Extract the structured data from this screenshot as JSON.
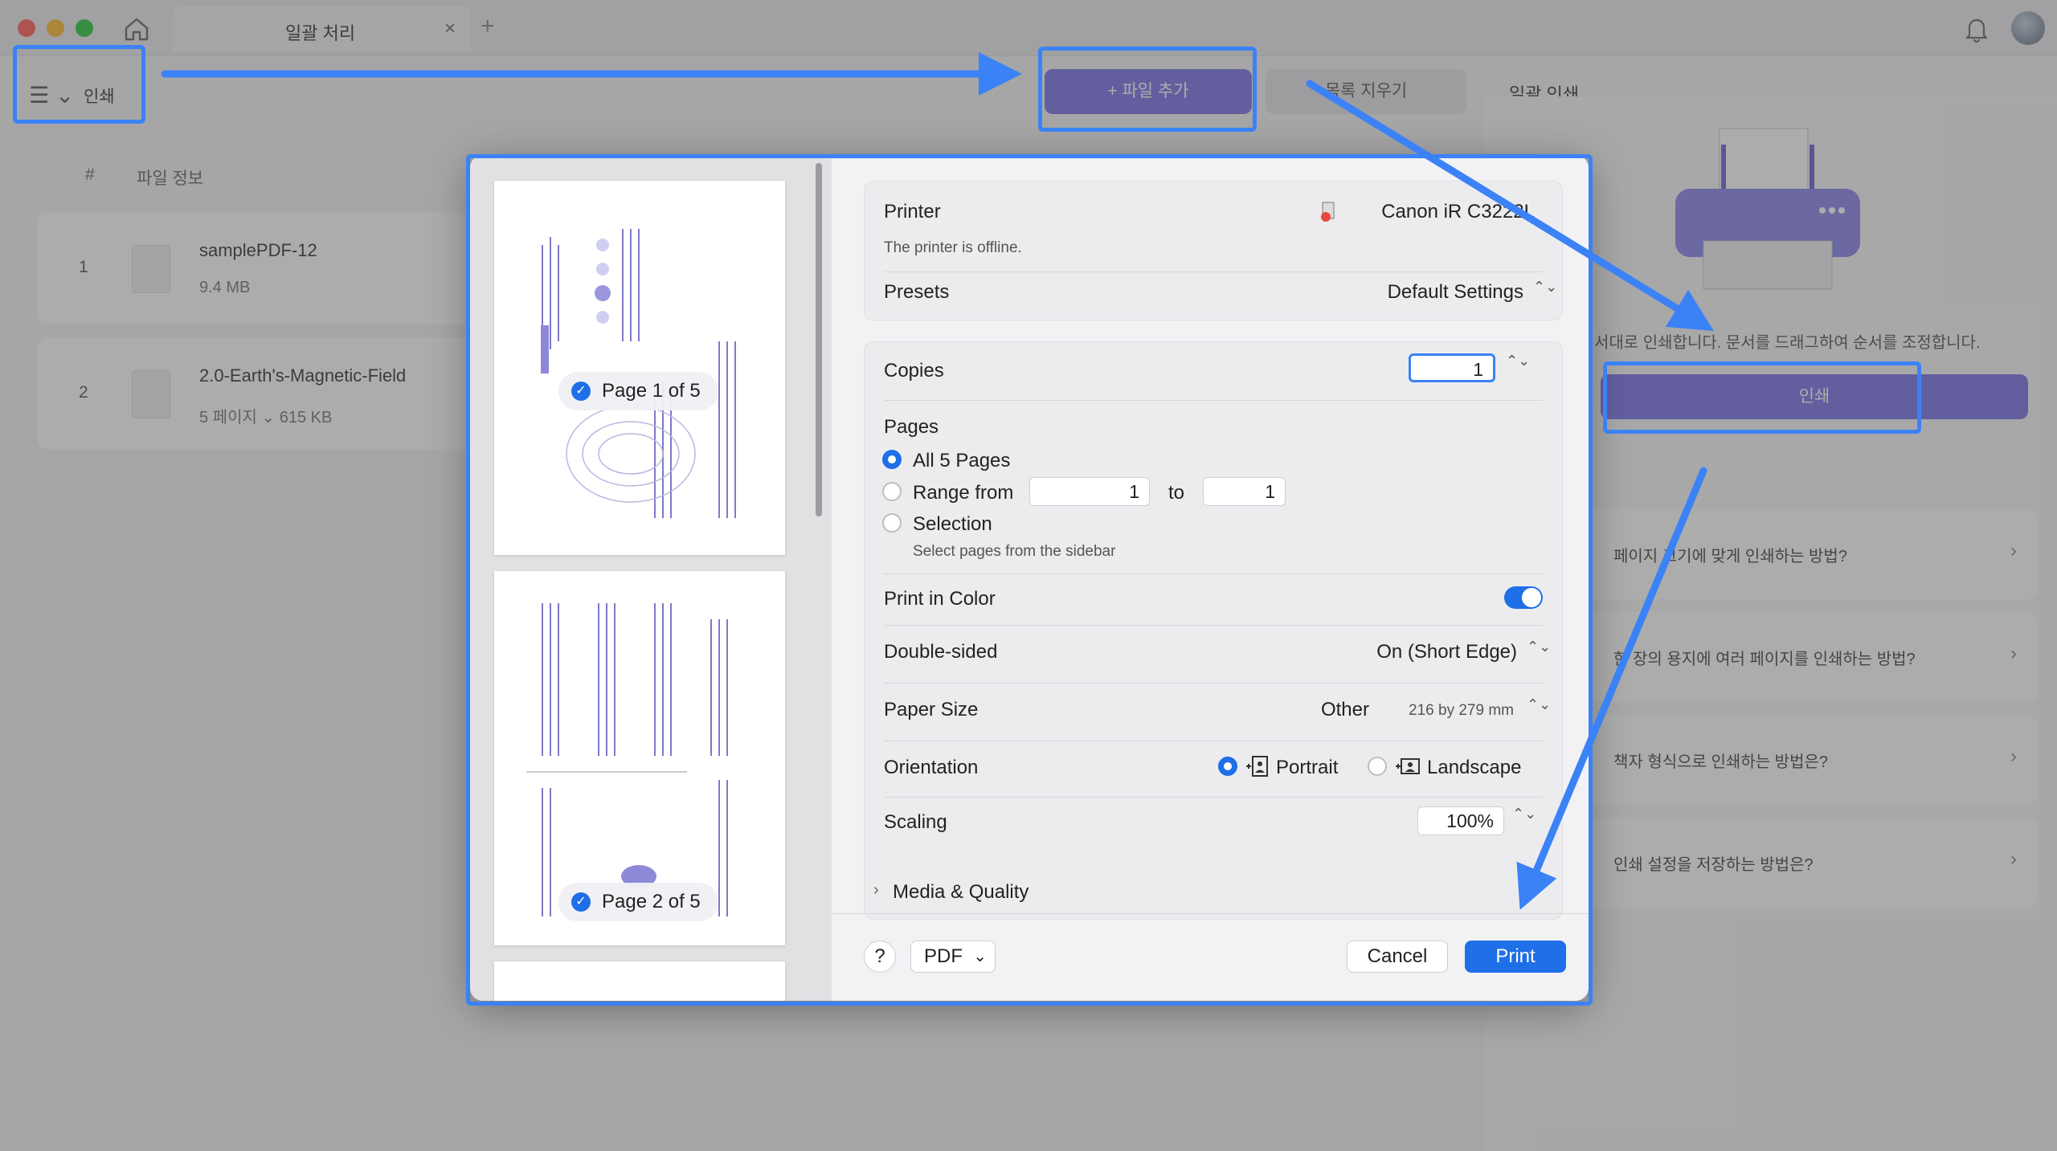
{
  "window": {
    "tab_title": "일괄 처리",
    "tab_close": "×",
    "tab_add": "+"
  },
  "menu": {
    "icon": "☰ ⌄",
    "label": "인쇄"
  },
  "toolbar": {
    "add_file_label": "+ 파일 추가",
    "clear_list_label": "목록 지우기",
    "batch_print_label": "일괄 인쇄"
  },
  "file_list": {
    "headers": {
      "number": "#",
      "info": "파일 정보"
    },
    "rows": [
      {
        "num": "1",
        "name": "samplePDF-12",
        "meta": "9.4 MB"
      },
      {
        "num": "2",
        "name": "2.0-Earth's-Magnetic-Field",
        "meta": "5 페이지 ⌄    615 KB"
      }
    ]
  },
  "right_panel": {
    "hint": "서대로 인쇄합니다. 문서를 드래그하여 순서를 조정합니다.",
    "print_button": "인쇄",
    "faq": [
      "페이지 크기에 맞게 인쇄하는 방법?",
      "한 장의 용지에 여러 페이지를 인쇄하는 방법?",
      "책자 형식으로 인쇄하는 방법은?",
      "인쇄 설정을 저장하는 방법은?"
    ],
    "faq_chevron": "›"
  },
  "print_dialog": {
    "thumbnails": [
      {
        "label": "Page 1 of 5",
        "selected": true
      },
      {
        "label": "Page 2 of 5",
        "selected": true
      }
    ],
    "checkmark": "✓",
    "printer": {
      "label": "Printer",
      "value": "Canon iR C3222L",
      "status": "The printer is offline."
    },
    "presets": {
      "label": "Presets",
      "value": "Default Settings"
    },
    "copies": {
      "label": "Copies",
      "value": "1"
    },
    "pages": {
      "label": "Pages",
      "all": "All 5 Pages",
      "range_label": "Range from",
      "range_from": "1",
      "range_to_label": "to",
      "range_to": "1",
      "selection": "Selection",
      "selection_hint": "Select pages from the sidebar",
      "selected_option": "all"
    },
    "print_in_color": {
      "label": "Print in Color",
      "enabled": true
    },
    "double_sided": {
      "label": "Double-sided",
      "value": "On (Short Edge)"
    },
    "paper_size": {
      "label": "Paper Size",
      "value": "Other",
      "detail": "216 by 279 mm"
    },
    "orientation": {
      "label": "Orientation",
      "portrait": "Portrait",
      "landscape": "Landscape",
      "selected": "portrait"
    },
    "scaling": {
      "label": "Scaling",
      "value": "100%"
    },
    "media_quality": {
      "label": "Media & Quality",
      "chevron": "›"
    },
    "help_label": "?",
    "pdf_label": "PDF",
    "pdf_chevron": "⌄",
    "cancel_label": "Cancel",
    "print_label": "Print",
    "stepper_glyph": "⌃⌄"
  },
  "colors": {
    "accent": "#7a73e8",
    "system_blue": "#1e6fe8",
    "annotation": "#3b82f6"
  }
}
